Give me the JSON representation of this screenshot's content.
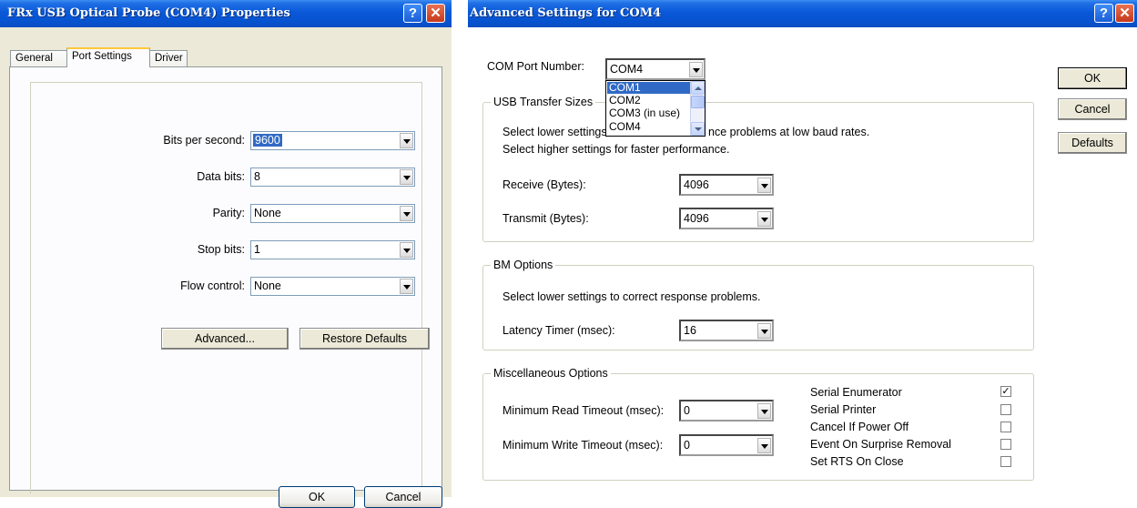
{
  "left_window": {
    "title": "FRx USB Optical Probe (COM4) Properties",
    "tabs": [
      {
        "label": "General",
        "active": false
      },
      {
        "label": "Port Settings",
        "active": true
      },
      {
        "label": "Driver",
        "active": false
      }
    ],
    "fields": [
      {
        "label": "Bits per second:",
        "value": "9600"
      },
      {
        "label": "Data bits:",
        "value": "8"
      },
      {
        "label": "Parity:",
        "value": "None"
      },
      {
        "label": "Stop bits:",
        "value": "1"
      },
      {
        "label": "Flow control:",
        "value": "None"
      }
    ],
    "advanced_button": "Advanced...",
    "restore_button": "Restore Defaults",
    "ok_button": "OK",
    "cancel_button": "Cancel"
  },
  "right_window": {
    "title": "Advanced Settings for COM4",
    "com_port_label": "COM Port Number:",
    "com_port_value": "COM4",
    "com_port_options": [
      "COM1",
      "COM2",
      "COM3 (in use)",
      "COM4"
    ],
    "com_port_highlighted": "COM1",
    "usb_group": {
      "legend": "USB Transfer Sizes",
      "desc1": "Select lower settings to correct performance problems at low baud rates.",
      "desc1_visible_left": "Select lower settings",
      "desc1_visible_right": "nce problems at low baud rates.",
      "desc2": "Select higher settings for faster performance.",
      "receive_label": "Receive (Bytes):",
      "receive_value": "4096",
      "transmit_label": "Transmit (Bytes):",
      "transmit_value": "4096"
    },
    "bm_group": {
      "legend": "BM Options",
      "desc": "Select lower settings to correct response problems.",
      "latency_label": "Latency Timer (msec):",
      "latency_value": "16"
    },
    "misc_group": {
      "legend": "Miscellaneous Options",
      "read_timeout_label": "Minimum Read Timeout (msec):",
      "read_timeout_value": "0",
      "write_timeout_label": "Minimum Write Timeout (msec):",
      "write_timeout_value": "0",
      "options": [
        {
          "label": "Serial Enumerator",
          "checked": true
        },
        {
          "label": "Serial Printer",
          "checked": false
        },
        {
          "label": "Cancel If Power Off",
          "checked": false
        },
        {
          "label": "Event On Surprise Removal",
          "checked": false
        },
        {
          "label": "Set RTS On Close",
          "checked": false
        }
      ]
    },
    "ok_button": "OK",
    "cancel_button": "Cancel",
    "defaults_button": "Defaults",
    "check_mark": "✓"
  },
  "title_buttons": {
    "help": "?",
    "close": "✕"
  }
}
